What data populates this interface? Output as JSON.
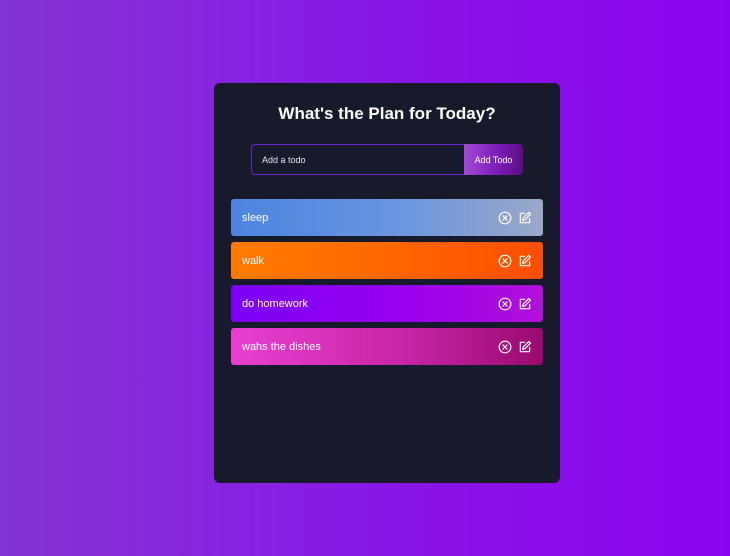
{
  "app": {
    "title": "What's the Plan for Today?"
  },
  "form": {
    "placeholder": "Add a todo",
    "value": "",
    "button_label": "Add Todo"
  },
  "todos": [
    {
      "text": "sleep",
      "remove_icon": "close-circle-icon",
      "edit_icon": "edit-icon"
    },
    {
      "text": "walk",
      "remove_icon": "close-circle-icon",
      "edit_icon": "edit-icon"
    },
    {
      "text": "do homework",
      "remove_icon": "close-circle-icon",
      "edit_icon": "edit-icon"
    },
    {
      "text": "wahs the dishes",
      "remove_icon": "close-circle-icon",
      "edit_icon": "edit-icon"
    }
  ],
  "colors": {
    "background": "#8a16e6",
    "panel": "#161a2b",
    "input_border": "#6f1fd6",
    "row_1": "#5d8fe0",
    "row_2": "#ff6a00",
    "row_3": "#8a05f0",
    "row_4": "#e040c8"
  }
}
